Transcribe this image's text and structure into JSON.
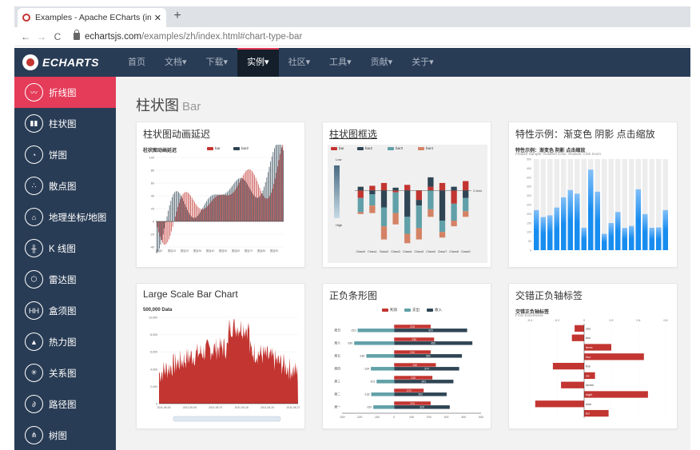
{
  "browser": {
    "tab_title": "Examples - Apache ECharts (in",
    "tab_close": "✕",
    "new_tab": "+",
    "url_host": "echartsjs.com",
    "url_path": "/examples/zh/index.html#chart-type-bar",
    "back": "←",
    "forward": "→",
    "reload": "C"
  },
  "site_nav": {
    "logo": "ECHARTS",
    "items": [
      "首页",
      "文档▾",
      "下载▾",
      "实例▾",
      "社区▾",
      "工具▾",
      "贡献▾",
      "关于▾"
    ],
    "active_index": 3
  },
  "sidebar": {
    "items": [
      {
        "label": "折线图",
        "icon": "line-chart-icon",
        "glyph": "〰"
      },
      {
        "label": "柱状图",
        "icon": "bar-chart-icon",
        "glyph": "▮▮"
      },
      {
        "label": "饼图",
        "icon": "pie-chart-icon",
        "glyph": "◔"
      },
      {
        "label": "散点图",
        "icon": "scatter-chart-icon",
        "glyph": "∴"
      },
      {
        "label": "地理坐标/地图",
        "icon": "map-icon",
        "glyph": "⌂"
      },
      {
        "label": "K 线图",
        "icon": "candlestick-icon",
        "glyph": "╫"
      },
      {
        "label": "雷达图",
        "icon": "radar-icon",
        "glyph": "⬡"
      },
      {
        "label": "盒须图",
        "icon": "boxplot-icon",
        "glyph": "HH"
      },
      {
        "label": "热力图",
        "icon": "heatmap-icon",
        "glyph": "▲"
      },
      {
        "label": "关系图",
        "icon": "graph-icon",
        "glyph": "✳"
      },
      {
        "label": "路径图",
        "icon": "lines-icon",
        "glyph": "∂"
      },
      {
        "label": "树图",
        "icon": "tree-icon",
        "glyph": "⋔"
      }
    ],
    "active_index": 0
  },
  "page": {
    "title": "柱状图",
    "title_en": "Bar"
  },
  "cards": [
    {
      "title": "柱状图动画延迟",
      "thumb_title": "柱状图动画延迟",
      "legend": [
        "bar",
        "bar2"
      ],
      "yticks": [
        "100",
        "80",
        "60",
        "40",
        "20",
        "0",
        "-20",
        "-40"
      ],
      "xticks": [
        "类目0",
        "类目10",
        "类目20",
        "类目30",
        "类目40",
        "类目50",
        "类目60",
        "类目70",
        "类目80",
        "类目90"
      ]
    },
    {
      "title": "柱状图框选",
      "legend": [
        "bar",
        "bar2",
        "bar3",
        "bar4"
      ],
      "visual_map": [
        "Low",
        "High"
      ],
      "axis_label": "X Axis",
      "xticks": [
        "Class0",
        "Class1",
        "Class2",
        "Class3",
        "Class4",
        "Class5",
        "Class6",
        "Class7",
        "Class8",
        "Class9"
      ]
    },
    {
      "title": "特性示例：渐变色 阴影 点击缩放",
      "thumb_title": "特性示例：渐变色 阴影 点击缩放",
      "thumb_subtitle": "Feature Sample: Gradient Color, Shadow, Click Zoom",
      "yticks": [
        "500",
        "450",
        "400",
        "350",
        "300",
        "250",
        "200",
        "150",
        "100",
        "50",
        "0"
      ]
    },
    {
      "title": "Large Scale Bar Chart",
      "thumb_title": "500,000 Data",
      "yticks": [
        "10,000",
        "8,000",
        "6,000",
        "4,000",
        "2,000",
        "0"
      ],
      "xticks": [
        "2011-06-04",
        "2011-06-05",
        "2011-06-07",
        "2011-06-18",
        "2011-06-20",
        "2011-06-27"
      ]
    },
    {
      "title": "正负条形图",
      "legend": [
        "利润",
        "支出",
        "收入"
      ],
      "rows": [
        "周日",
        "周六",
        "周五",
        "周四",
        "周三",
        "周二",
        "周一"
      ],
      "profit": [
        "210",
        "230",
        "210",
        "240",
        "220",
        "170",
        "210"
      ],
      "income": [
        "420",
        "450",
        "390",
        "374",
        "341",
        "302",
        "320"
      ],
      "expense": [
        "-210",
        "-230",
        "-160",
        "-134",
        "-101",
        "-132",
        "-120"
      ],
      "xticks": [
        "-300",
        "-200",
        "-100",
        "0",
        "100",
        "200",
        "300",
        "400",
        "500"
      ]
    },
    {
      "title": "交错正负轴标签",
      "thumb_title": "交错正负轴标签",
      "thumb_subtitle": "From ExcelHome",
      "xticks": [
        "-0.4",
        "-0.2",
        "0",
        "0.2",
        "0.4",
        "0.6"
      ],
      "labels": [
        "one",
        "two",
        "three",
        "four",
        "five",
        "six",
        "seven",
        "eight",
        "nine",
        "ten"
      ],
      "values": [
        -0.07,
        -0.09,
        0.2,
        0.44,
        -0.23,
        0.08,
        -0.17,
        0.47,
        -0.36,
        0.18
      ]
    }
  ],
  "colors": {
    "nav_bg": "#293c55",
    "accent": "#e43c59",
    "echarts_red": "#c23531",
    "echarts_dark": "#2f4554",
    "echarts_teal": "#61a0a8",
    "echarts_orange": "#d48265",
    "blue": "#188df0"
  }
}
